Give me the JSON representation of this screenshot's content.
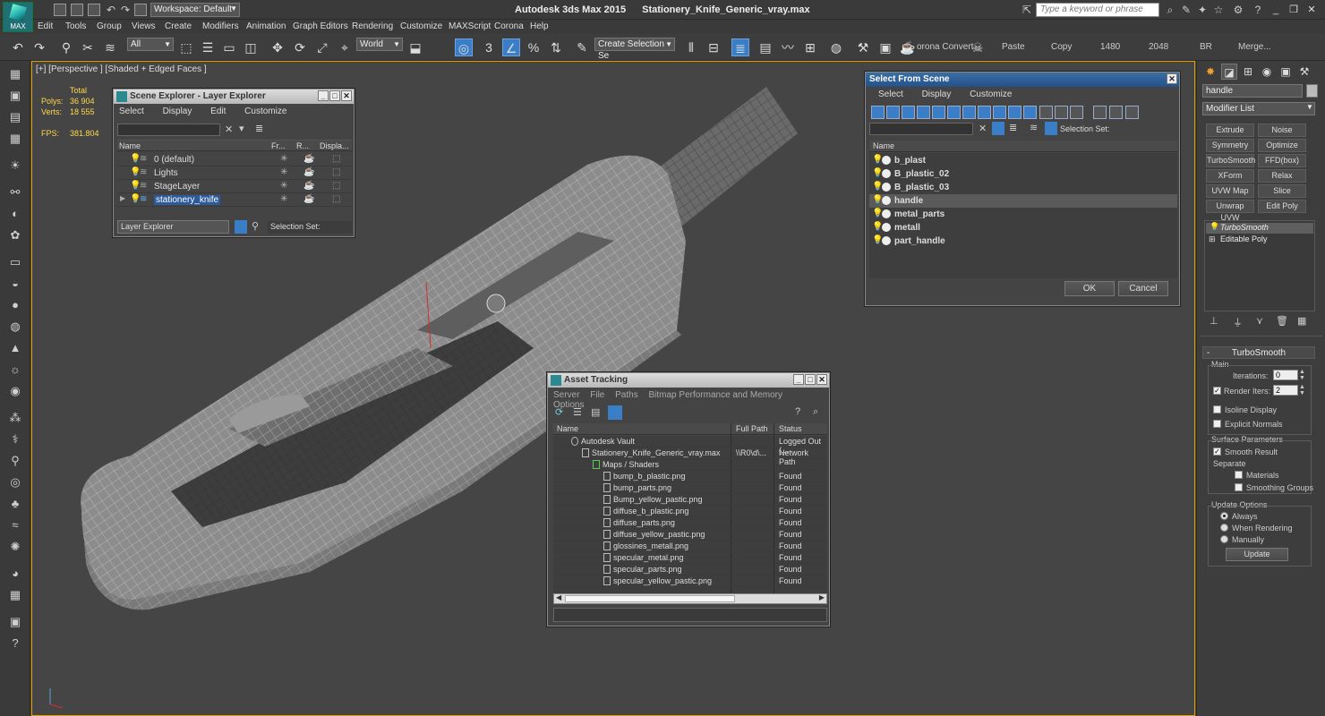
{
  "titlebar": {
    "logo_label": "MAX",
    "workspace": "Workspace: Default",
    "app_title": "Autodesk 3ds Max  2015",
    "file_name": "Stationery_Knife_Generic_vray.max",
    "search_placeholder": "Type a keyword or phrase"
  },
  "menu": [
    "Edit",
    "Tools",
    "Group",
    "Views",
    "Create",
    "Modifiers",
    "Animation",
    "Graph Editors",
    "Rendering",
    "Customize",
    "MAXScript",
    "Corona",
    "Help"
  ],
  "toolbar": {
    "filter": "All",
    "coord_system": "World",
    "snap_value": "3",
    "selection_set": "Create Selection Se",
    "corona_convert": "orona Convert",
    "paste": "Paste",
    "copy": "Copy",
    "width_value": "1480",
    "height_value": "2048",
    "br": "BR",
    "merge": "Merge..."
  },
  "viewport": {
    "label": "[+] [Perspective ] [Shaded + Edged Faces ]",
    "stats_header": "Total",
    "polys_label": "Polys:",
    "polys_value": "36 904",
    "verts_label": "Verts:",
    "verts_value": "18 555",
    "fps_label": "FPS:",
    "fps_value": "381.804"
  },
  "scene_explorer": {
    "title": "Scene Explorer - Layer Explorer",
    "menu": [
      "Select",
      "Display",
      "Edit",
      "Customize"
    ],
    "columns": [
      "Name",
      "Fr...",
      "R...",
      "Displa..."
    ],
    "rows": [
      {
        "name": "0 (default)"
      },
      {
        "name": "Lights"
      },
      {
        "name": "StageLayer"
      },
      {
        "name": "stationery_knife"
      }
    ],
    "footer_explorer": "Layer Explorer",
    "footer_selection": "Selection Set:"
  },
  "select_scene": {
    "title": "Select From Scene",
    "menu": [
      "Select",
      "Display",
      "Customize"
    ],
    "selection_set": "Selection Set:",
    "column": "Name",
    "rows": [
      "b_plast",
      "B_plastic_02",
      "B_plastic_03",
      "handle",
      "metal_parts",
      "metall",
      "part_handle"
    ],
    "ok": "OK",
    "cancel": "Cancel"
  },
  "asset_tracking": {
    "title": "Asset Tracking",
    "menu": [
      "Server",
      "File",
      "Paths",
      "Bitmap Performance and Memory",
      "Options"
    ],
    "columns": [
      "Name",
      "Full Path",
      "Status"
    ],
    "rows": [
      {
        "name": "Autodesk Vault",
        "path": "",
        "status": "Logged Out (..."
      },
      {
        "name": "Stationery_Knife_Generic_vray.max",
        "path": "\\\\R0\\d\\...",
        "status": "Network Path"
      },
      {
        "name": "Maps / Shaders",
        "path": "",
        "status": ""
      },
      {
        "name": "bump_b_plastic.png",
        "path": "",
        "status": "Found"
      },
      {
        "name": "bump_parts.png",
        "path": "",
        "status": "Found"
      },
      {
        "name": "Bump_yellow_pastic.png",
        "path": "",
        "status": "Found"
      },
      {
        "name": "diffuse_b_plastic.png",
        "path": "",
        "status": "Found"
      },
      {
        "name": "diffuse_parts.png",
        "path": "",
        "status": "Found"
      },
      {
        "name": "diffuse_yellow_pastic.png",
        "path": "",
        "status": "Found"
      },
      {
        "name": "glossines_metall.png",
        "path": "",
        "status": "Found"
      },
      {
        "name": "specular_metal.png",
        "path": "",
        "status": "Found"
      },
      {
        "name": "specular_parts.png",
        "path": "",
        "status": "Found"
      },
      {
        "name": "specular_yellow_pastic.png",
        "path": "",
        "status": "Found"
      }
    ]
  },
  "command_panel": {
    "object_name": "handle",
    "modifier_list": "Modifier List",
    "modifier_buttons": [
      "Extrude",
      "Noise",
      "Symmetry",
      "Optimize",
      "TurboSmooth",
      "FFD(box)",
      "XForm",
      "Relax",
      "UVW Map",
      "Slice",
      "Unwrap UVW",
      "Edit Poly"
    ],
    "stack": [
      "TurboSmooth",
      "Editable Poly"
    ],
    "rollout_title": "TurboSmooth",
    "main_label": "Main",
    "iterations_label": "Iterations:",
    "iterations_value": "0",
    "render_iters_label": "Render Iters:",
    "render_iters_value": "2",
    "isoline": "Isoline Display",
    "explicit_normals": "Explicit Normals",
    "surface_params": "Surface Parameters",
    "smooth_result": "Smooth Result",
    "separate": "Separate",
    "materials": "Materials",
    "smoothing_groups": "Smoothing Groups",
    "update_options": "Update Options",
    "always": "Always",
    "when_rendering": "When Rendering",
    "manually": "Manually",
    "update_button": "Update"
  },
  "colors": {
    "accent_blue": "#3b7ec8",
    "viewport_border": "#e0a000",
    "stats_yellow": "#ffd84a"
  }
}
